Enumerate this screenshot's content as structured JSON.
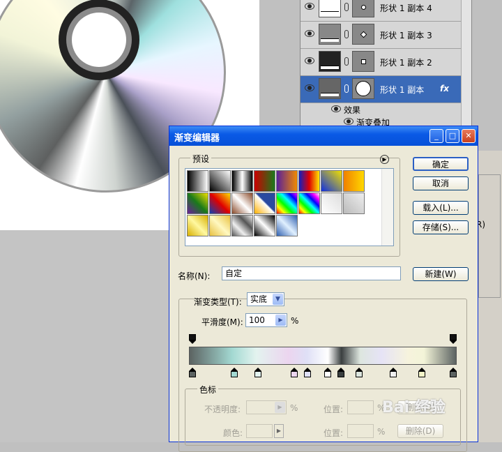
{
  "layers_panel": {
    "layers": [
      {
        "name": "形状 1 副本 4",
        "thumb_color": "#ffffff",
        "selected": false
      },
      {
        "name": "形状 1 副本 3",
        "thumb_color": "#888888",
        "selected": false
      },
      {
        "name": "形状 1 副本 2",
        "thumb_color": "#222222",
        "selected": false
      },
      {
        "name": "形状 1 副本",
        "thumb_color": "#666666",
        "selected": true
      }
    ],
    "fx_label": "fx",
    "effects_label": "效果",
    "gradient_overlay_label": "渐变叠加"
  },
  "dialog": {
    "title": "渐变编辑器",
    "presets_label": "预设",
    "buttons": {
      "ok": "确定",
      "cancel": "取消",
      "load": "载入(L)...",
      "save": "存储(S)...",
      "new": "新建(W)",
      "delete": "删除(D)"
    },
    "name_label": "名称(N):",
    "name_value": "自定",
    "gradient_type_label": "渐变类型(T):",
    "gradient_type_value": "实底",
    "smoothness_label": "平滑度(M):",
    "smoothness_value": "100",
    "percent": "%",
    "color_stops_label": "色标",
    "opacity_label": "不透明度:",
    "location_label": "位置:",
    "color_label": "颜色:",
    "right_panel_fragment": "R)"
  },
  "presets": [
    [
      "linear-gradient(to right,#000,#fff)",
      "linear-gradient(45deg,#000 0%,rgba(0,0,0,0) 100%)",
      "linear-gradient(to right,#000,#fff,#000)",
      "linear-gradient(to right,#c00,#1a7a1a)",
      "linear-gradient(to right,#5a1f9a,#f08a00)",
      "linear-gradient(to right,#1020c0,#e00000,#ffe800)",
      "linear-gradient(45deg,#1030e0,#f0e000)",
      "linear-gradient(to right,#f08000,#ffd800)"
    ],
    [
      "linear-gradient(45deg,#6a1f9a,#1a7a1a,#f0e000)",
      "linear-gradient(45deg,#1040b0,#e00000,#ffe000)",
      "linear-gradient(45deg,#8a4a2a,#fff,#8a4a2a)",
      "linear-gradient(45deg,#ffb000,#fff 50%,#2a4aa0 55%)",
      "linear-gradient(45deg,#f00,#ff0,#0f0,#0ff,#00f,#f0f)",
      "linear-gradient(45deg,#f00,#ff0,#0f0,#0ff,#00f,#f0f,#fff)",
      "linear-gradient(45deg,#ffffff,#dddddd)",
      "linear-gradient(45deg,#bbbbbb,#eeeeee)"
    ],
    [
      "linear-gradient(45deg,#d8b000,#fff8a0,#d8b000)",
      "linear-gradient(45deg,#e8c040,#fff8c0,#e8c040)",
      "linear-gradient(45deg,#555,#eee,#555,#eee)",
      "linear-gradient(45deg,#000,#fff,#000)",
      "linear-gradient(45deg,#3060b0,#e0f0ff,#3060b0)"
    ]
  ],
  "gradient_stops": {
    "opacity": [
      0.0,
      1.0
    ],
    "color": [
      {
        "pos": 0.0,
        "color": "#5c6362"
      },
      {
        "pos": 0.16,
        "color": "#a3d9d2"
      },
      {
        "pos": 0.25,
        "color": "#e3f3ef"
      },
      {
        "pos": 0.39,
        "color": "#ecd5ef"
      },
      {
        "pos": 0.44,
        "color": "#dfe0f6"
      },
      {
        "pos": 0.52,
        "color": "#ffffff"
      },
      {
        "pos": 0.57,
        "color": "#3a3f40"
      },
      {
        "pos": 0.64,
        "color": "#dde6df"
      },
      {
        "pos": 0.77,
        "color": "#f0f0f0"
      },
      {
        "pos": 0.88,
        "color": "#f3f4c8"
      },
      {
        "pos": 1.0,
        "color": "#5c6362"
      }
    ]
  },
  "watermark": "Bai 经验"
}
